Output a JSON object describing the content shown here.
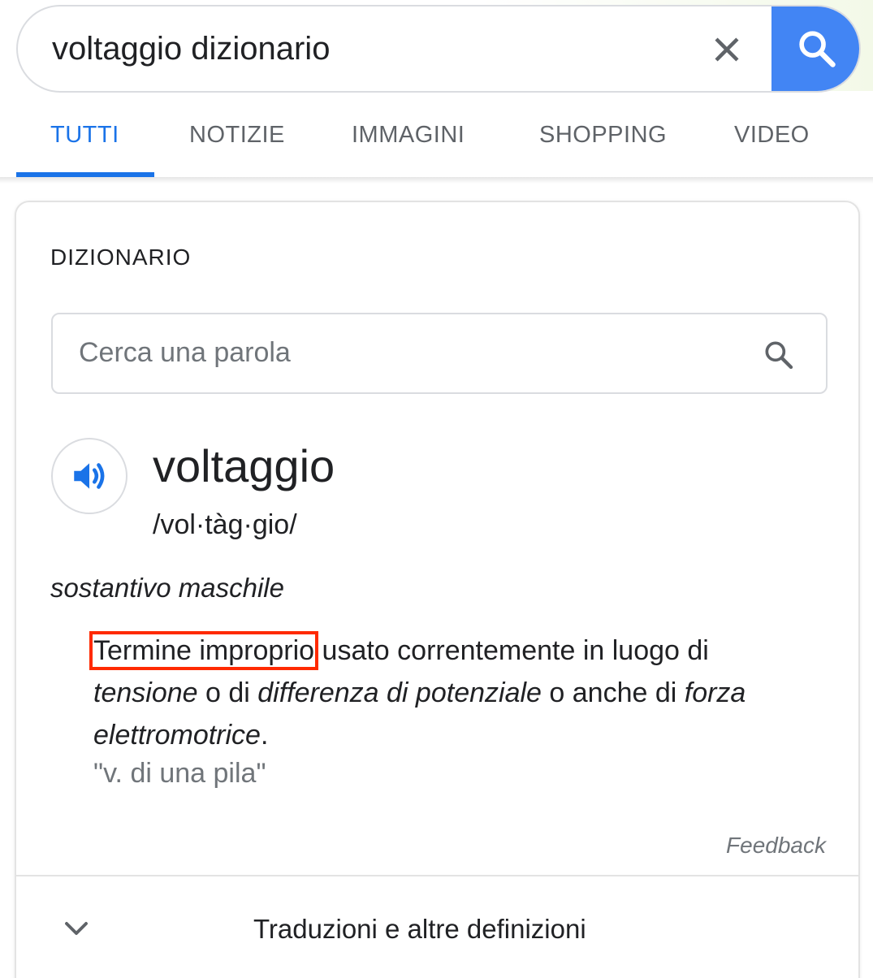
{
  "search": {
    "query": "voltaggio dizionario"
  },
  "tabs": [
    {
      "label": "TUTTI",
      "active": true
    },
    {
      "label": "NOTIZIE",
      "active": false
    },
    {
      "label": "IMMAGINI",
      "active": false
    },
    {
      "label": "SHOPPING",
      "active": false
    },
    {
      "label": "VIDEO",
      "active": false
    }
  ],
  "dictionary": {
    "title": "DIZIONARIO",
    "search_placeholder": "Cerca una parola",
    "headword": "voltaggio",
    "pronunciation": "/vol·tàg·gio/",
    "part_of_speech": "sostantivo maschile",
    "definition": {
      "highlighted": "Termine improprio",
      "after_highlight": " usato correntemente in luogo di ",
      "term1": "tensione",
      "connector1": " o di ",
      "term2": "differenza di potenziale",
      "connector2": " o anche di ",
      "term3": "forza elettromotrice",
      "end": "."
    },
    "example": "\"v. di una pila\"",
    "feedback": "Feedback",
    "expand_label": "Traduzioni e altre definizioni"
  },
  "colors": {
    "accent": "#1a73e8",
    "search_button": "#4285f4",
    "highlight_box": "#ff2a00",
    "text": "#202124",
    "muted": "#70757a"
  },
  "icons": {
    "clear": "close-icon",
    "search": "search-icon",
    "speaker": "speaker-icon",
    "expand": "chevron-down-icon"
  }
}
